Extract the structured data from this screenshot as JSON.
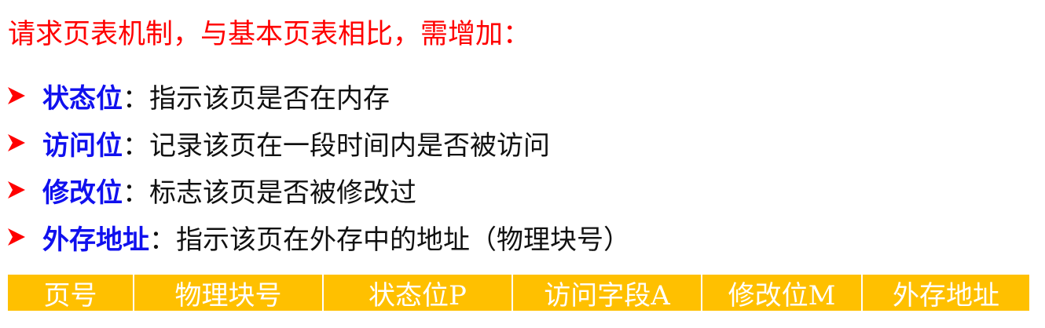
{
  "heading": "请求页表机制，与基本页表相比，需增加：",
  "colors": {
    "heading": "#ff0000",
    "term": "#1010ee",
    "arrow": "#ff0000",
    "table_bg": "#ffc000",
    "table_text": "#ffffff"
  },
  "bullets": [
    {
      "icon": "arrow-bullet-icon",
      "term": "状态位",
      "desc": "：指示该页是否在内存"
    },
    {
      "icon": "arrow-bullet-icon",
      "term": "访问位",
      "desc": "：记录该页在一段时间内是否被访问"
    },
    {
      "icon": "arrow-bullet-icon",
      "term": "修改位",
      "desc": "：标志该页是否被修改过"
    },
    {
      "icon": "arrow-bullet-icon",
      "term": "外存地址",
      "desc": "：指示该页在外存中的地址（物理块号）"
    }
  ],
  "table": {
    "columns": [
      "页号",
      "物理块号",
      "状态位P",
      "访问字段A",
      "修改位M",
      "外存地址"
    ]
  }
}
